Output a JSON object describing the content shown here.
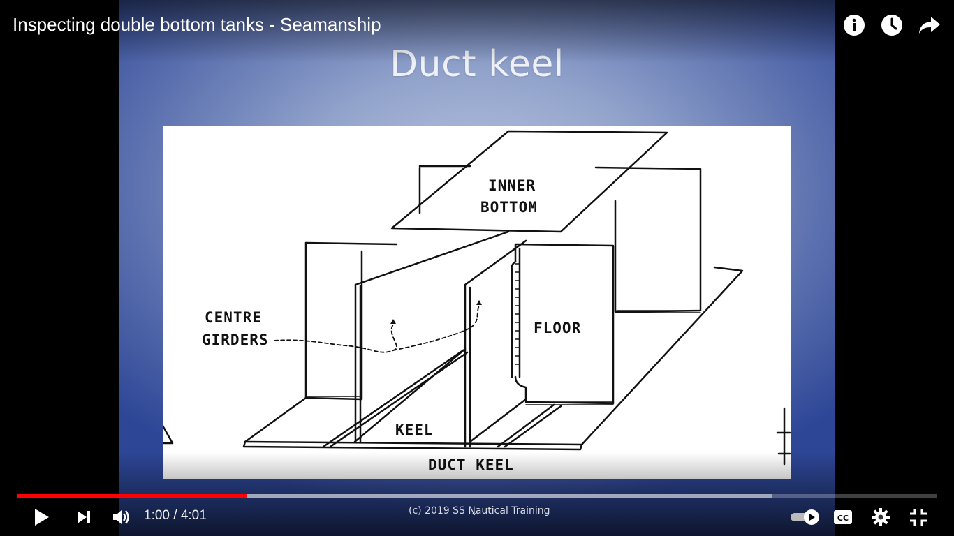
{
  "video": {
    "title": "Inspecting double bottom tanks - Seamanship",
    "time_current": "1:00",
    "time_separator": " / ",
    "time_total": "4:01",
    "progress_played": 0.25,
    "progress_buffered": 0.82
  },
  "slide": {
    "title": "Duct keel",
    "watermark": "(c) 2019 SS Nautical Training"
  },
  "diagram": {
    "labels": {
      "inner": "INNER",
      "bottom": "BOTTOM",
      "centre": "CENTRE",
      "girders": "GIRDERS",
      "floor": "FLOOR",
      "keel": "KEEL",
      "duct_keel": "DUCT KEEL"
    }
  },
  "icons": {
    "info": "info-icon",
    "watch_later": "clock-icon",
    "share": "share-icon",
    "play": "play-icon",
    "next": "next-icon",
    "volume": "volume-icon",
    "autoplay": "autoplay-toggle-icon",
    "captions": "captions-icon",
    "settings": "gear-icon",
    "exit_fullscreen": "exit-fullscreen-icon"
  },
  "colors": {
    "progress_played": "#ff0000",
    "slide_bg": "#2d4696"
  }
}
